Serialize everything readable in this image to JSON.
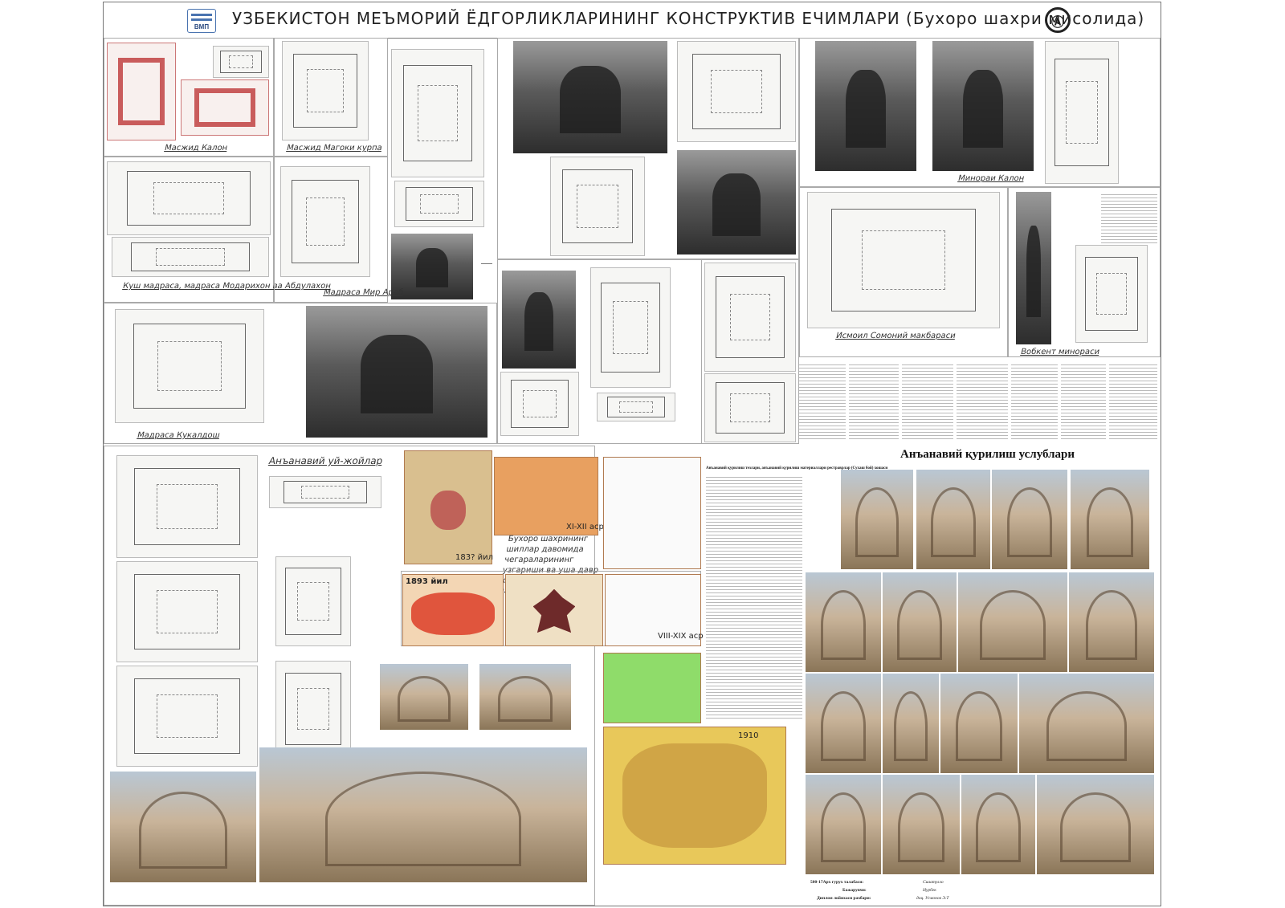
{
  "header": {
    "title": "УЗБЕКИСТОН МЕЪМОРИЙ ЁДГОРЛИКЛАРИНИНГ КОНСТРУКТИВ ЕЧИМЛАРИ (Бухоро шахри мисолида)",
    "left_logo_text": "ВМП"
  },
  "captions": {
    "masjid_kalon": "Масжид Калон",
    "masjid_magoki": "Масжид Магоки курпа",
    "kush_madrasa": "Куш мадраса, мадраса Модарихон ва Абдулахон",
    "mir_arab": "Мадраса Мир Араб",
    "kukaldosh": "Мадраса Кукалдош",
    "minorai_kalon": "Минораи Калон",
    "ismoil_somoni": "Исмоил Сомоний макбараси",
    "vobkent": "Вобкент минораси",
    "traditional_houses": "Анъанавий уй-жойлар",
    "construction_methods": "Анъанавий қурилиш услублари"
  },
  "maps": {
    "caption": "Бухоро шахрининг шиллар давомида чегараларининг узгариши ва уша давр хариталаридан намуналар",
    "years": {
      "y1": "183? йил",
      "y2": "XI-XII аср",
      "y3": "1893 йил",
      "y4": "VIII-XIX аср",
      "y5": "1910"
    }
  },
  "article": {
    "heading": "Анъанавий қурилиш тезлари, анъанавий қурилиш материаллари рестраврлар (Сухаш бой) хошаси"
  },
  "credits": {
    "line1_label": "500-17Арх гурух талабаси:",
    "line1_value": "Сиаатулло",
    "line2_label": "Бажарувчи:",
    "line2_value": "Нурбек",
    "line3_label": "Диплом лойихаси рахбари:",
    "line3_value": "доц. Усмонов Э.Т"
  },
  "colors": {
    "frame": "#777777",
    "map_red": "#e0553d",
    "map_green": "#8fdc6a",
    "plan_red": "#c95c5c"
  }
}
